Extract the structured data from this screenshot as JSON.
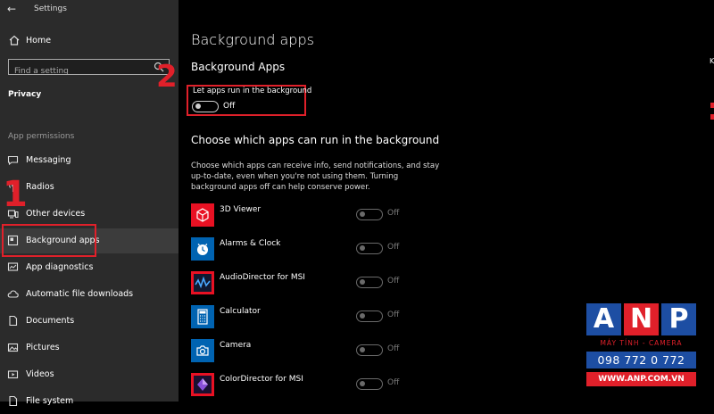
{
  "window": {
    "title": "Settings"
  },
  "sidebar": {
    "home_label": "Home",
    "search_placeholder": "Find a setting",
    "section_title": "Privacy",
    "group_label": "App permissions",
    "items": [
      {
        "label": "Messaging",
        "icon": "message-icon"
      },
      {
        "label": "Radios",
        "icon": "radio-icon"
      },
      {
        "label": "Other devices",
        "icon": "devices-icon"
      },
      {
        "label": "Background apps",
        "icon": "background-apps-icon",
        "active": true
      },
      {
        "label": "App diagnostics",
        "icon": "diagnostics-icon"
      },
      {
        "label": "Automatic file downloads",
        "icon": "cloud-icon"
      },
      {
        "label": "Documents",
        "icon": "document-icon"
      },
      {
        "label": "Pictures",
        "icon": "picture-icon"
      },
      {
        "label": "Videos",
        "icon": "video-icon"
      },
      {
        "label": "File system",
        "icon": "file-system-icon"
      }
    ]
  },
  "main": {
    "page_title": "Background apps",
    "section1_title": "Background Apps",
    "master_toggle": {
      "label": "Let apps run in the background",
      "state": "Off"
    },
    "section2_title": "Choose which apps can run in the background",
    "description": "Choose which apps can receive info, send notifications, and stay up-to-date, even when you're not using them. Turning background apps off can help conserve power.",
    "apps": [
      {
        "name": "3D Viewer",
        "state": "Off",
        "color": "#e81123"
      },
      {
        "name": "Alarms & Clock",
        "state": "Off",
        "color": "#0063b1"
      },
      {
        "name": "AudioDirector for MSI",
        "state": "Off",
        "color": "#e81123"
      },
      {
        "name": "Calculator",
        "state": "Off",
        "color": "#0063b1"
      },
      {
        "name": "Camera",
        "state": "Off",
        "color": "#0063b1"
      },
      {
        "name": "ColorDirector for MSI",
        "state": "Off",
        "color": "#e81123"
      }
    ]
  },
  "annotations": {
    "step1": "1",
    "step2": "2"
  },
  "edge": {
    "k": "K"
  },
  "watermark": {
    "letters": [
      "A",
      "N",
      "P"
    ],
    "tagline": "MÁY TÍNH - CAMERA",
    "phone": "098 772 0 772",
    "website": "WWW.ANP.COM.VN"
  },
  "colors": {
    "annotation_red": "#e0202a",
    "sidebar_bg": "#2b2b2b",
    "active_item_bg": "#3c3c3c",
    "brand_blue": "#1d4ea3"
  }
}
